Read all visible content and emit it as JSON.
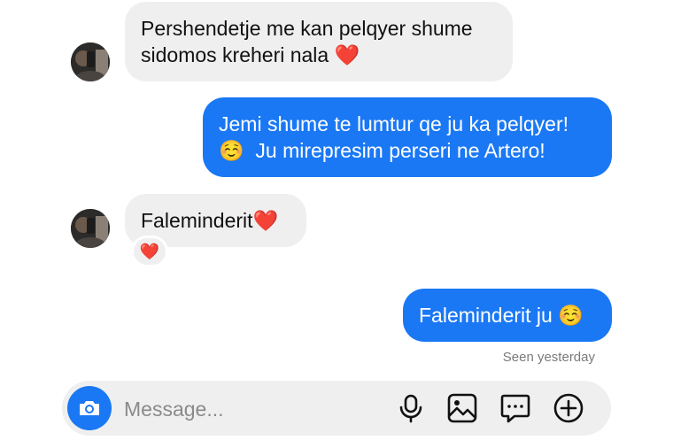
{
  "thread": {
    "messages": [
      {
        "sender": "contact",
        "lines": [
          "Pershendetje me kan pelqyer shume",
          "sidomos kreheri nala"
        ],
        "emoji": "❤️"
      },
      {
        "sender": "me",
        "line1": "Jemi shume te lumtur qe ju ka pelqyer!",
        "emoji": "☺️",
        "line2": "Ju mirepresim perseri ne Artero!"
      },
      {
        "sender": "contact",
        "text": "Faleminderit",
        "emoji": "❤️",
        "reaction": "❤️"
      },
      {
        "sender": "me",
        "text": "Faleminderit ju",
        "emoji": "☺️"
      }
    ],
    "seen_status": "Seen yesterday"
  },
  "composer": {
    "placeholder": "Message...",
    "icons": [
      "camera-icon",
      "microphone-icon",
      "gallery-icon",
      "sticker-chat-icon",
      "add-circle-icon"
    ]
  },
  "colors": {
    "outgoing_bubble": "#1a78f5",
    "incoming_bubble": "#efefef",
    "heart": "#e0202c",
    "seen_text": "#7a7a7a"
  }
}
